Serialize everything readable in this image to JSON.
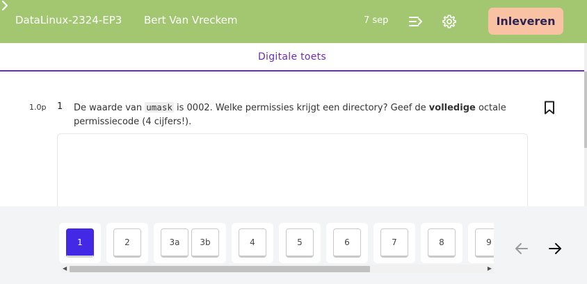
{
  "header": {
    "course": "DataLinux-2324-EP3",
    "student": "Bert Van Vreckem",
    "date": "7 sep",
    "submit_label": "Inleveren",
    "icons": [
      "chevron-right-icon",
      "menu-collapse-icon",
      "gear-icon"
    ],
    "bg_color": "#a3c771",
    "submit_color": "#f9c2a2"
  },
  "tab": {
    "title": "Digitale toets",
    "accent": "#6b2bbf"
  },
  "question": {
    "points": "1.0p",
    "number": "1",
    "text_before": "De waarde van ",
    "code": "umask",
    "text_middle": " is 0002. Welke permissies krijgt een directory? Geef de ",
    "bold": "volledige",
    "text_after": " octale permissiecode (4 cijfers!).",
    "answer": ""
  },
  "navigation": {
    "groups": [
      {
        "items": [
          "1"
        ]
      },
      {
        "items": [
          "2"
        ]
      },
      {
        "items": [
          "3a",
          "3b"
        ]
      },
      {
        "items": [
          "4"
        ]
      },
      {
        "items": [
          "5"
        ]
      },
      {
        "items": [
          "6"
        ]
      },
      {
        "items": [
          "7"
        ]
      },
      {
        "items": [
          "8"
        ]
      },
      {
        "items": [
          "9"
        ]
      }
    ],
    "active": "1",
    "active_color": "#4328e6",
    "prev_icon": "arrow-left-icon",
    "next_icon": "arrow-right-icon"
  }
}
